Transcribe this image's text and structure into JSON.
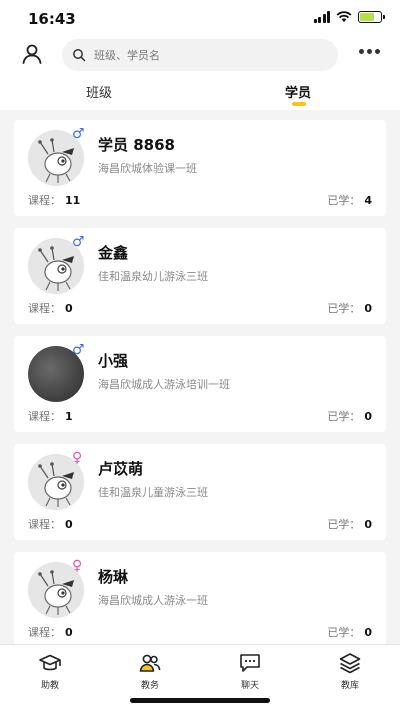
{
  "status": {
    "time": "16:43"
  },
  "search": {
    "placeholder": "班级、学员名"
  },
  "tabs": [
    {
      "label": "班级",
      "active": false
    },
    {
      "label": "学员",
      "active": true
    }
  ],
  "accent": "#f5c518",
  "students": [
    {
      "name": "学员 8868",
      "gender": "male",
      "gender_symbol": "♂",
      "klass": "海昌欣城体验课一班",
      "course_label": "课程：",
      "course_count": "11",
      "learned_label": "已学：",
      "learned_count": "4",
      "avatar": "ant-icon"
    },
    {
      "name": "金鑫",
      "gender": "male",
      "gender_symbol": "♂",
      "klass": "佳和温泉幼儿游泳三班",
      "course_label": "课程：",
      "course_count": "0",
      "learned_label": "已学：",
      "learned_count": "0",
      "avatar": "ant-icon"
    },
    {
      "name": "小强",
      "gender": "male",
      "gender_symbol": "♂",
      "klass": "海昌欣城成人游泳培训一班",
      "course_label": "课程：",
      "course_count": "1",
      "learned_label": "已学：",
      "learned_count": "0",
      "avatar": "photo"
    },
    {
      "name": "卢苡萌",
      "gender": "female",
      "gender_symbol": "♀",
      "klass": "佳和温泉儿童游泳三班",
      "course_label": "课程：",
      "course_count": "0",
      "learned_label": "已学：",
      "learned_count": "0",
      "avatar": "ant-icon"
    },
    {
      "name": "杨琳",
      "gender": "female",
      "gender_symbol": "♀",
      "klass": "海昌欣城成人游泳一班",
      "course_label": "课程：",
      "course_count": "0",
      "learned_label": "已学：",
      "learned_count": "0",
      "avatar": "ant-icon"
    }
  ],
  "bottom_nav": [
    {
      "label": "助教",
      "icon": "graduation-cap-icon"
    },
    {
      "label": "教务",
      "icon": "users-icon"
    },
    {
      "label": "聊天",
      "icon": "chat-icon"
    },
    {
      "label": "教库",
      "icon": "layers-icon"
    }
  ]
}
